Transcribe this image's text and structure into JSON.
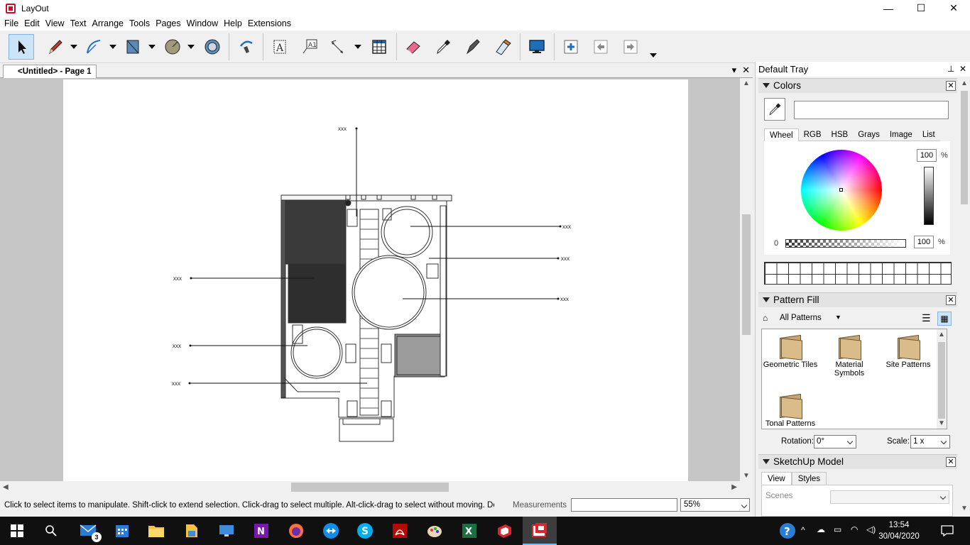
{
  "window": {
    "title": "LayOut",
    "min": "—",
    "max": "☐",
    "close": "✕"
  },
  "menu": [
    "File",
    "Edit",
    "View",
    "Text",
    "Arrange",
    "Tools",
    "Pages",
    "Window",
    "Help",
    "Extensions"
  ],
  "toolbar": {
    "tools": [
      "select-tool",
      "line-tool",
      "arc-tool",
      "rectangle-tool",
      "circle-tool",
      "polygon-tool",
      "offset-tool",
      "text-tool",
      "label-tool",
      "dimension-tool",
      "table-tool",
      "erase-tool",
      "style-tool",
      "split-tool",
      "join-tool",
      "presentation-tool",
      "add-page-tool",
      "previous-page-tool",
      "next-page-tool"
    ]
  },
  "document": {
    "tab_label": "<Untitled> - Page 1"
  },
  "drawing": {
    "label": "xxx"
  },
  "status": {
    "hint": "Click to select items to manipulate. Shift-click to extend selection. Click-drag to select multiple. Alt-click-drag to select without moving. Double-cli...",
    "measurements_label": "Measurements",
    "measurements_value": "",
    "zoom": "55%"
  },
  "tray": {
    "title": "Default Tray",
    "colors": {
      "title": "Colors",
      "tabs": [
        "Wheel",
        "RGB",
        "HSB",
        "Grays",
        "Image",
        "List"
      ],
      "active_tab": "Wheel",
      "brightness": "100",
      "opacity": "100",
      "pct": "%",
      "opacity_min": "0"
    },
    "pattern_fill": {
      "title": "Pattern Fill",
      "collection": "All Patterns",
      "folders": [
        "Geometric Tiles",
        "Material Symbols",
        "Site Patterns",
        "Tonal Patterns"
      ],
      "rotation_label": "Rotation:",
      "rotation_value": "0°",
      "scale_label": "Scale:",
      "scale_value": "1 x"
    },
    "sketchup_model": {
      "title": "SketchUp Model",
      "tabs": [
        "View",
        "Styles"
      ],
      "active_tab": "View",
      "scenes_label": "Scenes"
    }
  },
  "taskbar": {
    "mail_badge": "3",
    "time": "13:54",
    "date": "30/04/2020"
  }
}
